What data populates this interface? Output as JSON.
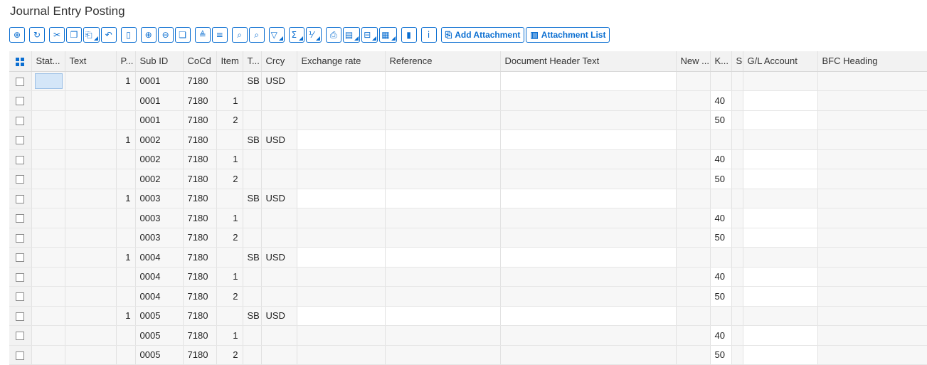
{
  "page": {
    "title": "Journal Entry Posting"
  },
  "toolbar": {
    "buttons": [
      {
        "icon": "magnify-icon",
        "glyph": "⊕"
      },
      {
        "icon": "refresh-icon",
        "glyph": "↻"
      },
      {
        "icon": "cut-icon",
        "glyph": "✂"
      },
      {
        "icon": "copy-icon",
        "glyph": "❐"
      },
      {
        "icon": "paste-icon",
        "glyph": "⎗"
      },
      {
        "icon": "undo-icon",
        "glyph": "↶"
      },
      {
        "icon": "new-icon",
        "glyph": "▯"
      },
      {
        "icon": "insert-row-icon",
        "glyph": "⊕"
      },
      {
        "icon": "delete-row-icon",
        "glyph": "⊖"
      },
      {
        "icon": "copy-row-icon",
        "glyph": "❏"
      },
      {
        "icon": "sort-ascending-icon",
        "glyph": "≜"
      },
      {
        "icon": "sort-descending-icon",
        "glyph": "≡"
      },
      {
        "icon": "find-icon",
        "glyph": "⌕"
      },
      {
        "icon": "find-next-icon",
        "glyph": "⌕"
      },
      {
        "icon": "filter-icon",
        "glyph": "▽"
      },
      {
        "icon": "sum-icon",
        "glyph": "Σ"
      },
      {
        "icon": "subtotal-icon",
        "glyph": "⅟"
      },
      {
        "icon": "print-icon",
        "glyph": "⎙"
      },
      {
        "icon": "export-icon",
        "glyph": "▤"
      },
      {
        "icon": "view-icon",
        "glyph": "⊟"
      },
      {
        "icon": "layout-icon",
        "glyph": "▦"
      },
      {
        "icon": "chart-icon",
        "glyph": "▮"
      },
      {
        "icon": "info-icon",
        "glyph": "i"
      }
    ],
    "add_attachment": {
      "label": "Add Attachment",
      "icon": "attachment-add-icon",
      "glyph": "⎘"
    },
    "attachment_list": {
      "label": "Attachment List",
      "icon": "attachment-list-icon",
      "glyph": "▥"
    }
  },
  "table": {
    "select_all_icon": "select-all-icon",
    "columns": [
      "Stat...",
      "Text",
      "P...",
      "Sub ID",
      "CoCd",
      "Item",
      "T...",
      "Crcy",
      "Exchange rate",
      "Reference",
      "Document Header Text",
      "New ...",
      "K...",
      "S(",
      "G/L Account",
      "BFC Heading"
    ],
    "rows": [
      {
        "stat": "",
        "text": "",
        "p": "1",
        "sub_id": "0001",
        "cocd": "7180",
        "item": "",
        "t": "SB",
        "crcy": "USD",
        "k": "",
        "header": true
      },
      {
        "stat": "",
        "text": "",
        "p": "",
        "sub_id": "0001",
        "cocd": "7180",
        "item": "1",
        "t": "",
        "crcy": "",
        "k": "40",
        "header": false
      },
      {
        "stat": "",
        "text": "",
        "p": "",
        "sub_id": "0001",
        "cocd": "7180",
        "item": "2",
        "t": "",
        "crcy": "",
        "k": "50",
        "header": false
      },
      {
        "stat": "",
        "text": "",
        "p": "1",
        "sub_id": "0002",
        "cocd": "7180",
        "item": "",
        "t": "SB",
        "crcy": "USD",
        "k": "",
        "header": true
      },
      {
        "stat": "",
        "text": "",
        "p": "",
        "sub_id": "0002",
        "cocd": "7180",
        "item": "1",
        "t": "",
        "crcy": "",
        "k": "40",
        "header": false
      },
      {
        "stat": "",
        "text": "",
        "p": "",
        "sub_id": "0002",
        "cocd": "7180",
        "item": "2",
        "t": "",
        "crcy": "",
        "k": "50",
        "header": false
      },
      {
        "stat": "",
        "text": "",
        "p": "1",
        "sub_id": "0003",
        "cocd": "7180",
        "item": "",
        "t": "SB",
        "crcy": "USD",
        "k": "",
        "header": true
      },
      {
        "stat": "",
        "text": "",
        "p": "",
        "sub_id": "0003",
        "cocd": "7180",
        "item": "1",
        "t": "",
        "crcy": "",
        "k": "40",
        "header": false
      },
      {
        "stat": "",
        "text": "",
        "p": "",
        "sub_id": "0003",
        "cocd": "7180",
        "item": "2",
        "t": "",
        "crcy": "",
        "k": "50",
        "header": false
      },
      {
        "stat": "",
        "text": "",
        "p": "1",
        "sub_id": "0004",
        "cocd": "7180",
        "item": "",
        "t": "SB",
        "crcy": "USD",
        "k": "",
        "header": true
      },
      {
        "stat": "",
        "text": "",
        "p": "",
        "sub_id": "0004",
        "cocd": "7180",
        "item": "1",
        "t": "",
        "crcy": "",
        "k": "40",
        "header": false
      },
      {
        "stat": "",
        "text": "",
        "p": "",
        "sub_id": "0004",
        "cocd": "7180",
        "item": "2",
        "t": "",
        "crcy": "",
        "k": "50",
        "header": false
      },
      {
        "stat": "",
        "text": "",
        "p": "1",
        "sub_id": "0005",
        "cocd": "7180",
        "item": "",
        "t": "SB",
        "crcy": "USD",
        "k": "",
        "header": true
      },
      {
        "stat": "",
        "text": "",
        "p": "",
        "sub_id": "0005",
        "cocd": "7180",
        "item": "1",
        "t": "",
        "crcy": "",
        "k": "40",
        "header": false
      },
      {
        "stat": "",
        "text": "",
        "p": "",
        "sub_id": "0005",
        "cocd": "7180",
        "item": "2",
        "t": "",
        "crcy": "",
        "k": "50",
        "header": false
      }
    ]
  }
}
